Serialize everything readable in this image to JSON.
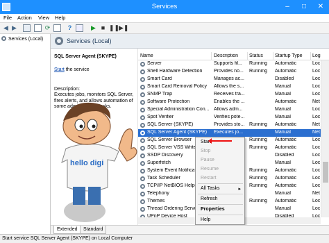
{
  "window": {
    "title": "Services",
    "controls": [
      "–",
      "□",
      "✕"
    ]
  },
  "menu": [
    "File",
    "Action",
    "View",
    "Help"
  ],
  "toolbar": {
    "icons": [
      "back-icon",
      "forward-icon",
      "console-tree-icon",
      "view-icon",
      "refresh-icon",
      "export-icon",
      "help-icon",
      "properties-icon",
      "start-icon",
      "stop-icon",
      "pause-icon",
      "restart-icon"
    ]
  },
  "tree": {
    "item": "Services (Local)"
  },
  "header": {
    "title": "Services (Local)"
  },
  "description_pane": {
    "service_name": "SQL Server Agent (SKYPE)",
    "start_link": "Start",
    "start_suffix": " the service",
    "description_label": "Description:",
    "description_text": "Executes jobs, monitors SQL Server, fires alerts, and allows automation of some administrative tasks."
  },
  "columns": [
    "Name",
    "Description",
    "Status",
    "Startup Type",
    "Log"
  ],
  "services": [
    {
      "name": "Server",
      "description": "Supports fil...",
      "status": "Running",
      "startup": "Automatic",
      "log": "Loc"
    },
    {
      "name": "Shell Hardware Detection",
      "description": "Provides no...",
      "status": "Running",
      "startup": "Automatic",
      "log": "Loc"
    },
    {
      "name": "Smart Card",
      "description": "Manages ac...",
      "status": "",
      "startup": "Disabled",
      "log": "Loc"
    },
    {
      "name": "Smart Card Removal Policy",
      "description": "Allows the s...",
      "status": "",
      "startup": "Manual",
      "log": "Loc"
    },
    {
      "name": "SNMP Trap",
      "description": "Receives tra...",
      "status": "",
      "startup": "Manual",
      "log": "Loc"
    },
    {
      "name": "Software Protection",
      "description": "Enables the ...",
      "status": "",
      "startup": "Automatic",
      "log": "Net"
    },
    {
      "name": "Special Administration Con...",
      "description": "Allows adm...",
      "status": "",
      "startup": "Manual",
      "log": "Loc"
    },
    {
      "name": "Spot Verifier",
      "description": "Verifies pote...",
      "status": "",
      "startup": "Manual",
      "log": "Loc"
    },
    {
      "name": "SQL Server (SKYPE)",
      "description": "Provides sto...",
      "status": "Running",
      "startup": "Automatic",
      "log": "Net"
    },
    {
      "name": "SQL Server Agent (SKYPE)",
      "description": "Executes jo...",
      "status": "",
      "startup": "Manual",
      "log": "Net",
      "selected": true
    },
    {
      "name": "SQL Server Browser",
      "description": "",
      "status": "Running",
      "startup": "Automatic",
      "log": "Loc"
    },
    {
      "name": "SQL Server VSS Writer",
      "description": "",
      "status": "Running",
      "startup": "Automatic",
      "log": "Loc"
    },
    {
      "name": "SSDP Discovery",
      "description": "",
      "status": "",
      "startup": "Disabled",
      "log": "Loc"
    },
    {
      "name": "Superfetch",
      "description": "",
      "status": "",
      "startup": "Manual",
      "log": "Loc"
    },
    {
      "name": "System Event Notification",
      "description": "",
      "status": "Running",
      "startup": "Automatic",
      "log": "Loc"
    },
    {
      "name": "Task Scheduler",
      "description": "",
      "status": "Running",
      "startup": "Automatic",
      "log": "Loc"
    },
    {
      "name": "TCP/IP NetBIOS Helper",
      "description": "",
      "status": "Running",
      "startup": "Automatic",
      "log": "Loc"
    },
    {
      "name": "Telephony",
      "description": "",
      "status": "",
      "startup": "Manual",
      "log": "Net"
    },
    {
      "name": "Themes",
      "description": "",
      "status": "Running",
      "startup": "Automatic",
      "log": "Loc"
    },
    {
      "name": "Thread Ordering Server",
      "description": "",
      "status": "",
      "startup": "Manual",
      "log": "Loc"
    },
    {
      "name": "UPnP Device Host",
      "description": "",
      "status": "",
      "startup": "Disabled",
      "log": "Loc"
    }
  ],
  "context_menu": {
    "start": "Start",
    "stop": "Stop",
    "pause": "Pause",
    "resume": "Resume",
    "restart": "Restart",
    "all_tasks": "All Tasks",
    "refresh": "Refresh",
    "properties": "Properties",
    "help": "Help"
  },
  "mascot": {
    "shirt_text": "hello digi"
  },
  "tabs": [
    "Extended",
    "Standard"
  ],
  "status_bar": "Start service SQL Server Agent (SKYPE) on Local Computer",
  "colors": {
    "titlebar": "#1e90ff",
    "selection": "#2b6fd0",
    "annotation_arrow": "#ee1111"
  }
}
